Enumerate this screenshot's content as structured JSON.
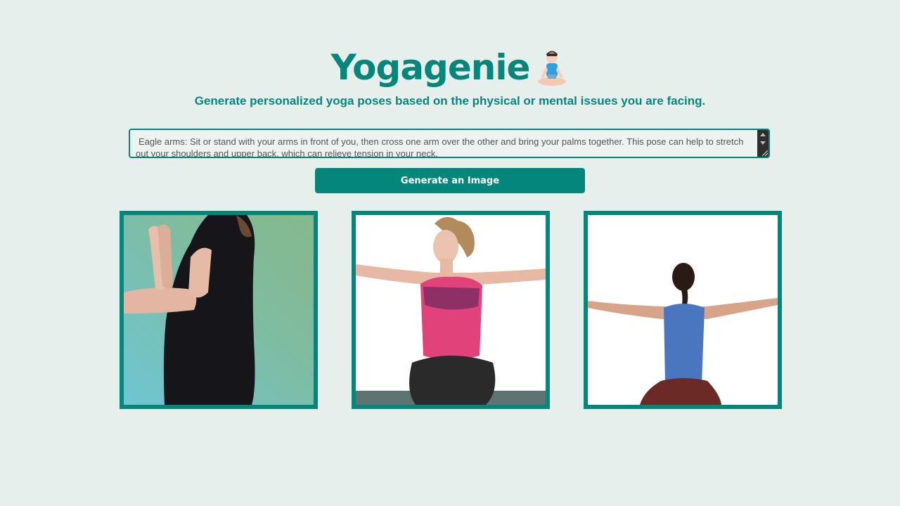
{
  "header": {
    "title": "Yogagenie",
    "title_icon": "person-in-lotus-position-icon",
    "subtitle": "Generate personalized yoga poses based on the physical or mental issues you are facing."
  },
  "prompt": {
    "value": "Eagle arms: Sit or stand with your arms in front of you, then cross one arm over the other and bring your palms together. This pose can help to stretch out your shoulders and upper back, which can relieve tension in your neck."
  },
  "actions": {
    "generate_label": "Generate an Image"
  },
  "gallery": {
    "images": [
      {
        "subject": "side view of woman in black top with palms pressed together in eagle arms"
      },
      {
        "subject": "woman in pink top seated with arms extended wide to both sides"
      },
      {
        "subject": "back view of woman in blue top seated with arms stretched out to sides"
      }
    ]
  },
  "colors": {
    "accent": "#04877a",
    "background": "#e7efed"
  }
}
